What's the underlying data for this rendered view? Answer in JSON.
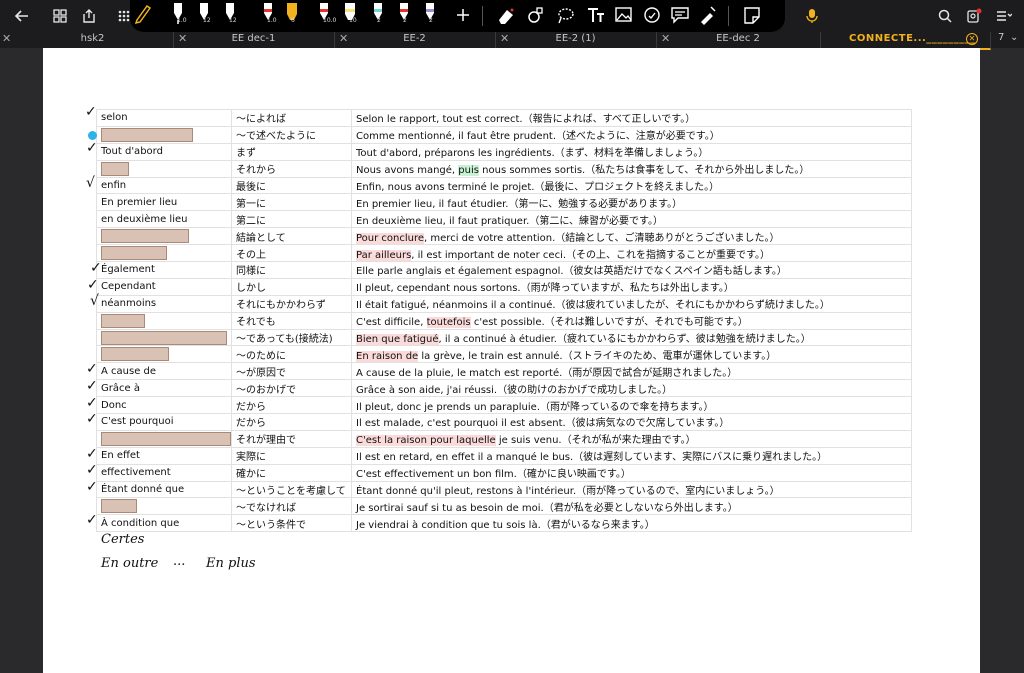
{
  "tabs": {
    "items": [
      {
        "label": "hsk2"
      },
      {
        "label": "EE dec-1"
      },
      {
        "label": "EE-2"
      },
      {
        "label": "EE-2 (1)"
      },
      {
        "label": "EE-dec 2"
      },
      {
        "label": "CONNECTE..._________"
      }
    ],
    "overflow": "7"
  },
  "toolbar": {
    "pens": [
      {
        "size": "1.0",
        "color": "#ffffff",
        "icon": "pencil-icon"
      },
      {
        "size": "12",
        "color": "#ffffff",
        "icon": "pen-icon"
      },
      {
        "size": "12",
        "color": "#ffffff",
        "icon": "pen-icon"
      },
      {
        "size": "1.0",
        "color": "#e0322e",
        "icon": "pen-icon"
      },
      {
        "size": "6",
        "color": "#f2b11f",
        "icon": "highlighter-icon"
      },
      {
        "size": "10.0",
        "color": "#e0322e",
        "icon": "pen-icon"
      },
      {
        "size": "10",
        "color": "#f4e27a",
        "icon": "highlighter-icon"
      },
      {
        "size": "2",
        "color": "#6fd3d7",
        "icon": "pen-icon"
      },
      {
        "size": "2",
        "color": "#e0322e",
        "icon": "pen-icon"
      },
      {
        "size": "2",
        "color": "#9b8ed6",
        "icon": "pen-icon"
      }
    ]
  },
  "vocab": {
    "rows": [
      {
        "fr": "selon",
        "ja": "〜によれば",
        "ex": "Selon le rapport, tout est correct.（報告によれば、すべて正しいです。）"
      },
      {
        "fr": "",
        "ja": "〜で述べたように",
        "ex": "Comme mentionné, il faut être prudent.（述べたように、注意が必要です。）"
      },
      {
        "fr": "Tout d'abord",
        "ja": "まず",
        "ex": "Tout d'abord, préparons les ingrédients.（まず、材料を準備しましょう。）"
      },
      {
        "fr": "",
        "ja": "それから",
        "ex": "Nous avons mangé, puis nous sommes sortis.（私たちは食事をして、それから外出しました。）"
      },
      {
        "fr": "enfin",
        "ja": "最後に",
        "ex": "Enfin, nous avons terminé le projet.（最後に、プロジェクトを終えました。）"
      },
      {
        "fr": "En premier lieu",
        "ja": "第一に",
        "ex": "En premier lieu, il faut étudier.（第一に、勉強する必要があります。）"
      },
      {
        "fr": "en deuxième lieu",
        "ja": "第二に",
        "ex": "En deuxième lieu, il faut pratiquer.（第二に、練習が必要です。）"
      },
      {
        "fr": "",
        "ja": "結論として",
        "ex": "Pour conclure, merci de votre attention.（結論として、ご清聴ありがとうございました。）"
      },
      {
        "fr": "",
        "ja": "その上",
        "ex": "Par ailleurs, il est important de noter ceci.（その上、これを指摘することが重要です。）"
      },
      {
        "fr": "Également",
        "ja": "同様に",
        "ex": "Elle parle anglais et également espagnol.（彼女は英語だけでなくスペイン語も話します。）"
      },
      {
        "fr": "Cependant",
        "ja": "しかし",
        "ex": "Il pleut, cependant nous sortons.（雨が降っていますが、私たちは外出します。）"
      },
      {
        "fr": "néanmoins",
        "ja": "それにもかかわらず",
        "ex": "Il était fatigué, néanmoins il a continué.（彼は疲れていましたが、それにもかかわらず続けました。）"
      },
      {
        "fr": "",
        "ja": "それでも",
        "ex": "C'est difficile, toutefois c'est possible.（それは難しいですが、それでも可能です。）"
      },
      {
        "fr": "",
        "ja": "〜であっても(接続法)",
        "ex": "Bien que fatigué, il a continué à étudier.（疲れているにもかかわらず、彼は勉強を続けました。）"
      },
      {
        "fr": "",
        "ja": "〜のために",
        "ex": "En raison de la grève, le train est annulé.（ストライキのため、電車が運休しています。）"
      },
      {
        "fr": "A cause de",
        "ja": "〜が原因で",
        "ex": "A cause de la pluie, le match est reporté.（雨が原因で試合が延期されました。）"
      },
      {
        "fr": "Grâce à",
        "ja": "〜のおかげで",
        "ex": "Grâce à son aide, j'ai réussi.（彼の助けのおかげで成功しました。）"
      },
      {
        "fr": "Donc",
        "ja": "だから",
        "ex": "Il pleut, donc je prends un parapluie.（雨が降っているので傘を持ちます。）"
      },
      {
        "fr": "C'est pourquoi",
        "ja": "だから",
        "ex": "Il est malade, c'est pourquoi il est absent.（彼は病気なので欠席しています。）"
      },
      {
        "fr": "",
        "ja": "それが理由で",
        "ex": "C'est la raison pour laquelle je suis venu.（それが私が来た理由です。）"
      },
      {
        "fr": "En effet",
        "ja": "実際に",
        "ex": "Il est en retard, en effet il a manqué le bus.（彼は遅刻しています、実際にバスに乗り遅れました。）"
      },
      {
        "fr": "effectivement",
        "ja": "確かに",
        "ex": "C'est effectivement un bon film.（確かに良い映画です。）"
      },
      {
        "fr": "Étant donné que",
        "ja": "〜ということを考慮して",
        "ex": "Étant donné qu'il pleut, restons à l'intérieur.（雨が降っているので、室内にいましょう。）"
      },
      {
        "fr": "",
        "ja": "〜でなければ",
        "ex": "Je sortirai sauf si tu as besoin de moi.（君が私を必要としないなら外出します。）"
      },
      {
        "fr": "À condition que",
        "ja": "〜という条件で",
        "ex": "Je viendrai à condition que tu sois là.（君がいるなら来ます。）"
      }
    ]
  },
  "highlights": {
    "h3": "puis",
    "h7": "Pour conclure",
    "h8": "Par ailleurs",
    "h12": "toutefois",
    "h13": "Bien que fatigué",
    "h14": "En raison de",
    "h19": "C'est la raison pour laquelle"
  },
  "handwriting": {
    "line1": "Certes",
    "line2a": "En outre",
    "line2b": "...",
    "line2c": "En plus"
  }
}
